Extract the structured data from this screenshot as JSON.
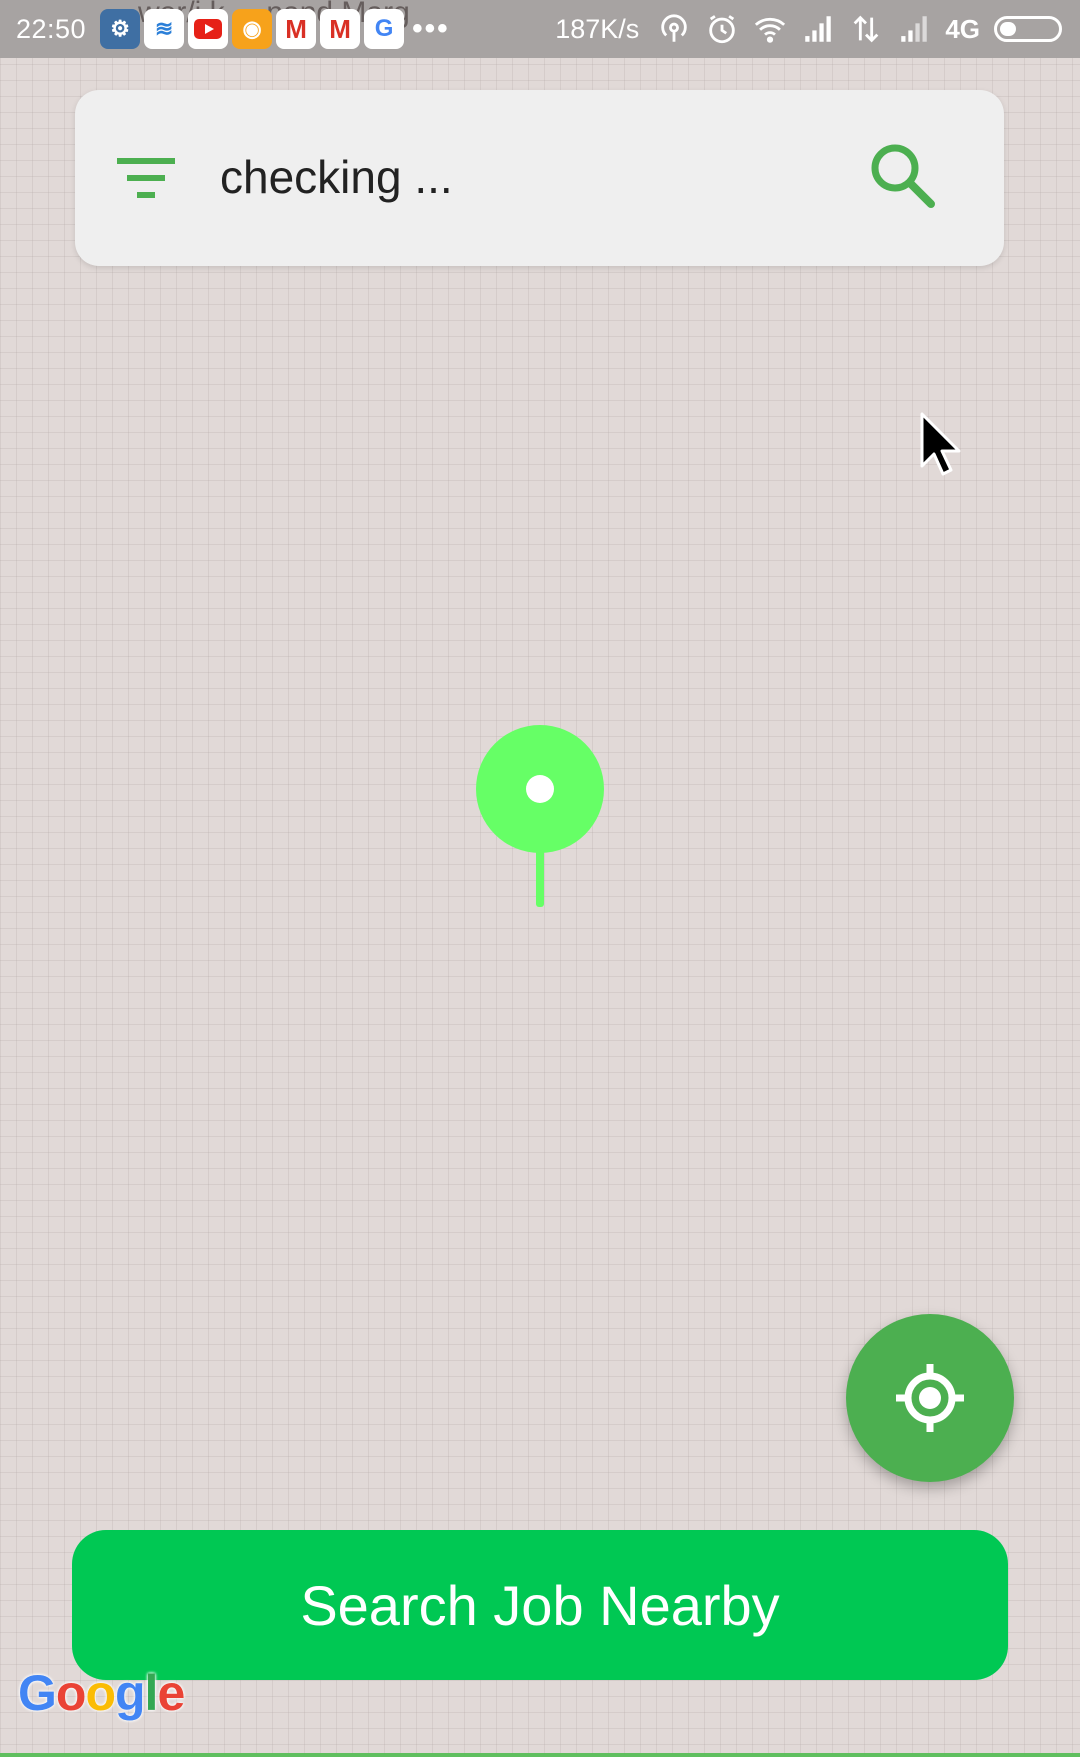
{
  "status_bar": {
    "time": "22:50",
    "ghost_text": "wer/i k ... nand Marg",
    "notification_icons": [
      "settings-icon",
      "app-icon",
      "youtube-icon",
      "orange-app-icon",
      "gmail-icon",
      "gmail-icon",
      "google-icon"
    ],
    "more": "•••",
    "net_speed": "187K/s",
    "network_type": "4G",
    "battery_level": 0.25
  },
  "search_bar": {
    "text": "checking ...",
    "filter_icon": "filter-icon",
    "search_icon": "search-icon"
  },
  "map": {
    "pin_icon": "location-pin-icon",
    "locate_icon": "my-location-icon",
    "attribution": [
      "G",
      "o",
      "o",
      "g",
      "l",
      "e"
    ]
  },
  "actions": {
    "search_job_label": "Search Job Nearby"
  },
  "colors": {
    "accent_green": "#4caf50",
    "pin_green": "#66ff66",
    "button_green": "#00c853",
    "map_background": "#e1d9d7"
  }
}
